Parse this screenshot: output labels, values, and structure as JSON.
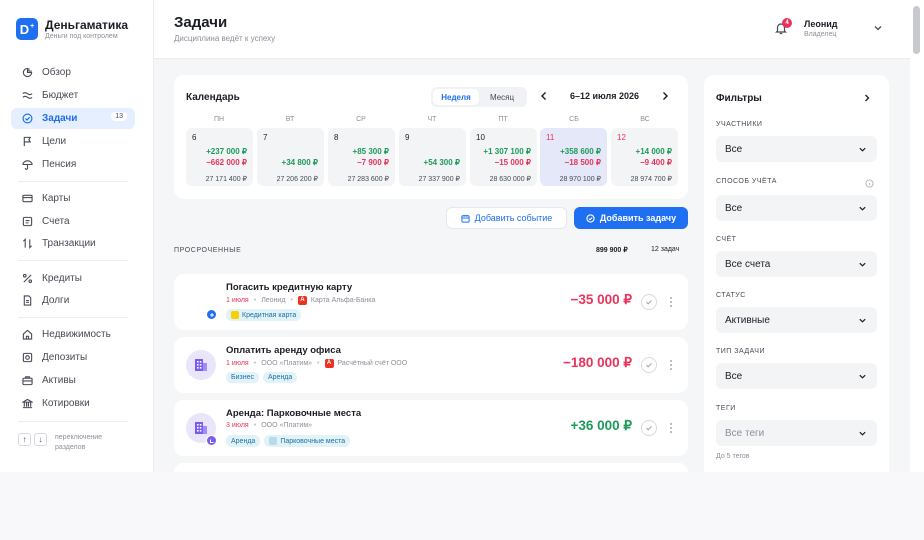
{
  "brand": {
    "logo_letter": "D",
    "logo_plus": "+",
    "name": "Деньгаматика",
    "tagline": "Деньги под контролем"
  },
  "sidebar": {
    "items": [
      {
        "label": "Обзор",
        "icon": "overview-icon"
      },
      {
        "label": "Бюджет",
        "icon": "budget-icon"
      },
      {
        "label": "Задачи",
        "icon": "tasks-icon",
        "badge": "13",
        "active": true
      },
      {
        "label": "Цели",
        "icon": "flag-icon"
      },
      {
        "label": "Пенсия",
        "icon": "pension-icon"
      },
      {
        "label": "Карты",
        "icon": "card-icon"
      },
      {
        "label": "Счета",
        "icon": "accounts-icon"
      },
      {
        "label": "Транзакции",
        "icon": "transfer-icon"
      },
      {
        "label": "Кредиты",
        "icon": "percent-icon"
      },
      {
        "label": "Долги",
        "icon": "document-icon"
      },
      {
        "label": "Недвижимость",
        "icon": "house-icon"
      },
      {
        "label": "Депозиты",
        "icon": "safe-icon"
      },
      {
        "label": "Активы",
        "icon": "briefcase-icon"
      },
      {
        "label": "Котировки",
        "icon": "bank-icon"
      }
    ],
    "section_switch": {
      "up_key": "↑",
      "down_key": "↓",
      "label": "переключение разделов"
    }
  },
  "header": {
    "title": "Задачи",
    "subtitle": "Дисциплина ведёт к успеху",
    "notifications_count": "4",
    "user": {
      "name": "Леонид",
      "role": "Владелец"
    }
  },
  "calendar": {
    "title": "Календарь",
    "view_options": [
      "Неделя",
      "Месяц"
    ],
    "active_view": "Неделя",
    "week_label": "6–12 июля 2026",
    "weekdays": [
      "ПН",
      "ВТ",
      "СР",
      "ЧТ",
      "ПТ",
      "СБ",
      "ВС"
    ],
    "days": [
      {
        "day": "6",
        "income": "+237 000 ₽",
        "expense": "−662 000 ₽",
        "balance": "27 171 400 ₽"
      },
      {
        "day": "7",
        "income": "+34 800 ₽",
        "expense": "",
        "balance": "27 206 200 ₽"
      },
      {
        "day": "8",
        "income": "+85 300 ₽",
        "expense": "−7 900 ₽",
        "balance": "27 283 600 ₽"
      },
      {
        "day": "9",
        "income": "+54 300 ₽",
        "expense": "",
        "balance": "27 337 900 ₽"
      },
      {
        "day": "10",
        "income": "+1 307 100 ₽",
        "expense": "−15 000 ₽",
        "balance": "28 630 000 ₽"
      },
      {
        "day": "11",
        "income": "+358 600 ₽",
        "expense": "−18 500 ₽",
        "balance": "28 970 100 ₽",
        "today": true
      },
      {
        "day": "12",
        "income": "+14 000 ₽",
        "expense": "−9 400 ₽",
        "balance": "28 974 700 ₽"
      }
    ]
  },
  "actions": {
    "add_event": "Добавить событие",
    "add_task": "Добавить задачу"
  },
  "overdue": {
    "label": "ПРОСРОЧЕННЫЕ",
    "total": "899 900 ₽",
    "count": "12 задач",
    "tasks": [
      {
        "title": "Погасить кредитную карту",
        "date": "1 июля",
        "person": "Леонид",
        "account": "Карта Альфа-Банка",
        "tags": [
          "Кредитная карта"
        ],
        "amount": "−35 000 ₽"
      },
      {
        "title": "Оплатить аренду офиса",
        "date": "1 июля",
        "person": "ООО «Платим»",
        "account": "Расчётный счёт ООО",
        "tags": [
          "Бизнес",
          "Аренда"
        ],
        "amount": "−180 000 ₽"
      },
      {
        "title": "Аренда: Парковочные места",
        "date": "3 июля",
        "person": "ООО «Платим»",
        "account": "",
        "tags": [
          "Аренда",
          "Парковочные места"
        ],
        "amount": "+36 000 ₽"
      }
    ]
  },
  "filters": {
    "title": "Фильтры",
    "groups": [
      {
        "label": "УЧАСТНИКИ",
        "value": "Все"
      },
      {
        "label": "СПОСОБ УЧЁТА",
        "value": "Все"
      },
      {
        "label": "СЧЁТ",
        "value": "Все счета"
      },
      {
        "label": "СТАТУС",
        "value": "Активные"
      },
      {
        "label": "ТИП ЗАДАЧИ",
        "value": "Все"
      },
      {
        "label": "ТЕГИ",
        "value": "Все теги"
      }
    ],
    "tags_note": "До 5 тегов"
  },
  "colors": {
    "accent": "#1f6ff2",
    "income": "#1d9a5a",
    "expense": "#e8345b"
  }
}
